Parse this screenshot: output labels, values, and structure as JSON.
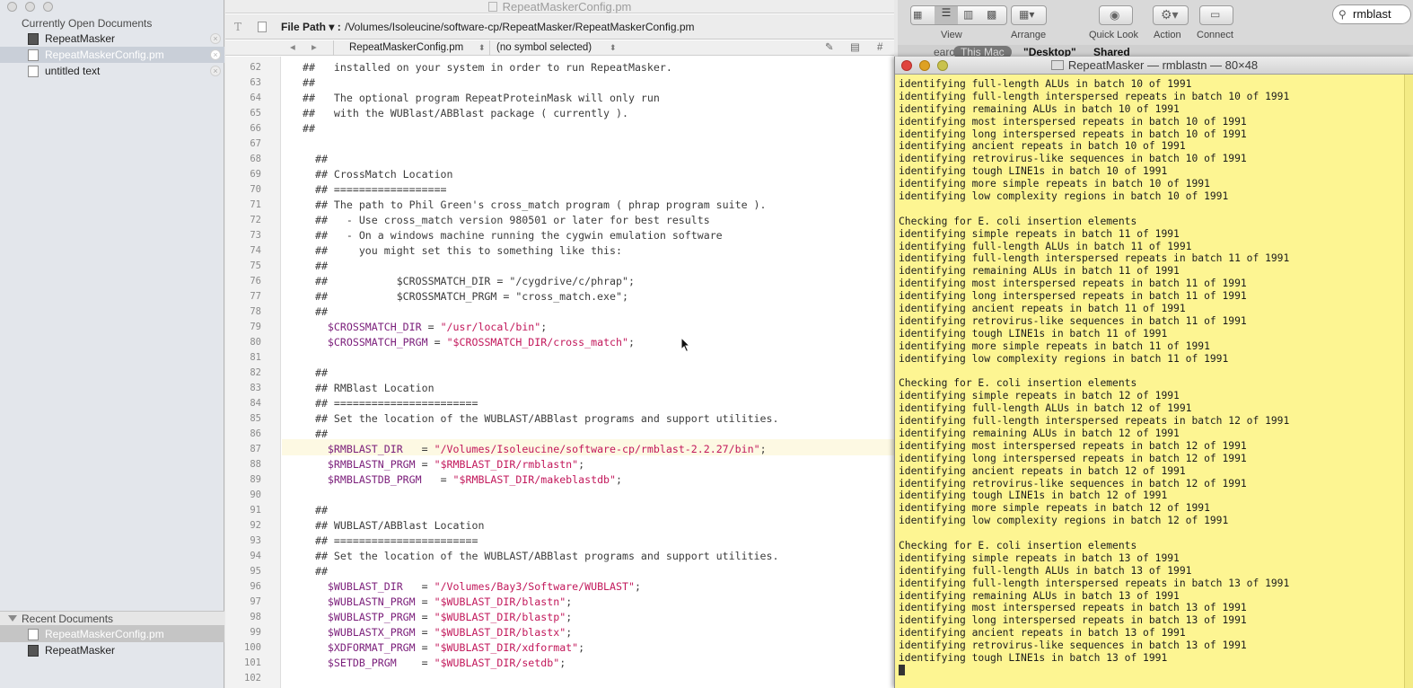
{
  "sidebar": {
    "open_header": "Currently Open Documents",
    "open_docs": [
      {
        "label": "RepeatMasker"
      },
      {
        "label": "RepeatMaskerConfig.pm"
      },
      {
        "label": "untitled text"
      }
    ],
    "recent_header": "Recent Documents",
    "recent_docs": [
      {
        "label": "RepeatMaskerConfig.pm"
      },
      {
        "label": "RepeatMasker"
      }
    ]
  },
  "editor": {
    "window_title": "RepeatMaskerConfig.pm",
    "path_label": "File Path ▾ :",
    "path_value": "/Volumes/Isoleucine/software-cp/RepeatMasker/RepeatMaskerConfig.pm",
    "nav_file": "RepeatMaskerConfig.pm",
    "nav_symbol": "(no symbol selected)",
    "lines": [
      {
        "n": "62",
        "parts": [
          {
            "t": "##   installed on your system in order to run RepeatMasker.",
            "c": ""
          }
        ]
      },
      {
        "n": "63",
        "parts": [
          {
            "t": "##",
            "c": ""
          }
        ]
      },
      {
        "n": "64",
        "parts": [
          {
            "t": "##   The optional program RepeatProteinMask will only run",
            "c": ""
          }
        ]
      },
      {
        "n": "65",
        "parts": [
          {
            "t": "##   with the WUBlast/ABBlast package ( currently ).",
            "c": ""
          }
        ]
      },
      {
        "n": "66",
        "parts": [
          {
            "t": "##",
            "c": ""
          }
        ]
      },
      {
        "n": "67",
        "parts": [
          {
            "t": "",
            "c": ""
          }
        ]
      },
      {
        "n": "68",
        "parts": [
          {
            "t": "  ##",
            "c": ""
          }
        ]
      },
      {
        "n": "69",
        "parts": [
          {
            "t": "  ## CrossMatch Location",
            "c": ""
          }
        ]
      },
      {
        "n": "70",
        "parts": [
          {
            "t": "  ## ==================",
            "c": ""
          }
        ]
      },
      {
        "n": "71",
        "parts": [
          {
            "t": "  ## The path to Phil Green's cross_match program ( phrap program suite ).",
            "c": ""
          }
        ]
      },
      {
        "n": "72",
        "parts": [
          {
            "t": "  ##   - Use cross_match version 980501 or later for best results",
            "c": ""
          }
        ]
      },
      {
        "n": "73",
        "parts": [
          {
            "t": "  ##   - On a windows machine running the cygwin emulation software",
            "c": ""
          }
        ]
      },
      {
        "n": "74",
        "parts": [
          {
            "t": "  ##     you might set this to something like this:",
            "c": ""
          }
        ]
      },
      {
        "n": "75",
        "parts": [
          {
            "t": "  ##",
            "c": ""
          }
        ]
      },
      {
        "n": "76",
        "parts": [
          {
            "t": "  ##           $CROSSMATCH_DIR = \"/cygdrive/c/phrap\";",
            "c": ""
          }
        ]
      },
      {
        "n": "77",
        "parts": [
          {
            "t": "  ##           $CROSSMATCH_PRGM = \"cross_match.exe\";",
            "c": ""
          }
        ]
      },
      {
        "n": "78",
        "parts": [
          {
            "t": "  ##",
            "c": ""
          }
        ]
      },
      {
        "n": "79",
        "parts": [
          {
            "t": "    $CROSSMATCH_DIR",
            "c": "var"
          },
          {
            "t": " = ",
            "c": ""
          },
          {
            "t": "\"/usr/local/bin\"",
            "c": "str"
          },
          {
            "t": ";",
            "c": ""
          }
        ]
      },
      {
        "n": "80",
        "parts": [
          {
            "t": "    $CROSSMATCH_PRGM",
            "c": "var"
          },
          {
            "t": " = ",
            "c": ""
          },
          {
            "t": "\"$CROSSMATCH_DIR/cross_match\"",
            "c": "str"
          },
          {
            "t": ";",
            "c": ""
          }
        ]
      },
      {
        "n": "81",
        "parts": [
          {
            "t": "",
            "c": ""
          }
        ]
      },
      {
        "n": "82",
        "parts": [
          {
            "t": "  ##",
            "c": ""
          }
        ]
      },
      {
        "n": "83",
        "parts": [
          {
            "t": "  ## RMBlast Location",
            "c": ""
          }
        ]
      },
      {
        "n": "84",
        "parts": [
          {
            "t": "  ## =======================",
            "c": ""
          }
        ]
      },
      {
        "n": "85",
        "parts": [
          {
            "t": "  ## Set the location of the WUBLAST/ABBlast programs and support utilities.",
            "c": ""
          }
        ]
      },
      {
        "n": "86",
        "parts": [
          {
            "t": "  ##",
            "c": ""
          }
        ]
      },
      {
        "n": "87",
        "parts": [
          {
            "t": "    $RMBLAST_DIR",
            "c": "var"
          },
          {
            "t": "   = ",
            "c": ""
          },
          {
            "t": "\"/Volumes/Isoleucine/software-cp/rmblast-2.2.27/bin\"",
            "c": "str"
          },
          {
            "t": ";",
            "c": ""
          }
        ]
      },
      {
        "n": "88",
        "parts": [
          {
            "t": "    $RMBLASTN_PRGM",
            "c": "var"
          },
          {
            "t": " = ",
            "c": ""
          },
          {
            "t": "\"$RMBLAST_DIR/rmblastn\"",
            "c": "str"
          },
          {
            "t": ";",
            "c": ""
          }
        ]
      },
      {
        "n": "89",
        "parts": [
          {
            "t": "    $RMBLASTDB_PRGM",
            "c": "var"
          },
          {
            "t": "   = ",
            "c": ""
          },
          {
            "t": "\"$RMBLAST_DIR/makeblastdb\"",
            "c": "str"
          },
          {
            "t": ";",
            "c": ""
          }
        ]
      },
      {
        "n": "90",
        "parts": [
          {
            "t": "",
            "c": ""
          }
        ]
      },
      {
        "n": "91",
        "parts": [
          {
            "t": "  ##",
            "c": ""
          }
        ]
      },
      {
        "n": "92",
        "parts": [
          {
            "t": "  ## WUBLAST/ABBlast Location",
            "c": ""
          }
        ]
      },
      {
        "n": "93",
        "parts": [
          {
            "t": "  ## =======================",
            "c": ""
          }
        ]
      },
      {
        "n": "94",
        "parts": [
          {
            "t": "  ## Set the location of the WUBLAST/ABBlast programs and support utilities.",
            "c": ""
          }
        ]
      },
      {
        "n": "95",
        "parts": [
          {
            "t": "  ##",
            "c": ""
          }
        ]
      },
      {
        "n": "96",
        "parts": [
          {
            "t": "    $WUBLAST_DIR",
            "c": "var"
          },
          {
            "t": "   = ",
            "c": ""
          },
          {
            "t": "\"/Volumes/Bay3/Software/WUBLAST\"",
            "c": "str"
          },
          {
            "t": ";",
            "c": ""
          }
        ]
      },
      {
        "n": "97",
        "parts": [
          {
            "t": "    $WUBLASTN_PRGM",
            "c": "var"
          },
          {
            "t": " = ",
            "c": ""
          },
          {
            "t": "\"$WUBLAST_DIR/blastn\"",
            "c": "str"
          },
          {
            "t": ";",
            "c": ""
          }
        ]
      },
      {
        "n": "98",
        "parts": [
          {
            "t": "    $WUBLASTP_PRGM",
            "c": "var"
          },
          {
            "t": " = ",
            "c": ""
          },
          {
            "t": "\"$WUBLAST_DIR/blastp\"",
            "c": "str"
          },
          {
            "t": ";",
            "c": ""
          }
        ]
      },
      {
        "n": "99",
        "parts": [
          {
            "t": "    $WUBLASTX_PRGM",
            "c": "var"
          },
          {
            "t": " = ",
            "c": ""
          },
          {
            "t": "\"$WUBLAST_DIR/blastx\"",
            "c": "str"
          },
          {
            "t": ";",
            "c": ""
          }
        ]
      },
      {
        "n": "100",
        "parts": [
          {
            "t": "    $XDFORMAT_PRGM",
            "c": "var"
          },
          {
            "t": " = ",
            "c": ""
          },
          {
            "t": "\"$WUBLAST_DIR/xdformat\"",
            "c": "str"
          },
          {
            "t": ";",
            "c": ""
          }
        ]
      },
      {
        "n": "101",
        "parts": [
          {
            "t": "    $SETDB_PRGM",
            "c": "var"
          },
          {
            "t": "    = ",
            "c": ""
          },
          {
            "t": "\"$WUBLAST_DIR/setdb\"",
            "c": "str"
          },
          {
            "t": ";",
            "c": ""
          }
        ]
      },
      {
        "n": "102",
        "parts": [
          {
            "t": "",
            "c": ""
          }
        ]
      }
    ]
  },
  "finder": {
    "view_label": "View",
    "arrange_label": "Arrange",
    "quicklook_label": "Quick Look",
    "action_label": "Action",
    "connect_label": "Connect",
    "search_value": "rmblast",
    "scope_search": "earch:",
    "scope_this_mac": "This Mac",
    "scope_desktop": "\"Desktop\"",
    "scope_shared": "Shared"
  },
  "terminal": {
    "title": "RepeatMasker — rmblastn — 80×48",
    "lines": [
      "identifying full-length ALUs in batch 10 of 1991",
      "identifying full-length interspersed repeats in batch 10 of 1991",
      "identifying remaining ALUs in batch 10 of 1991",
      "identifying most interspersed repeats in batch 10 of 1991",
      "identifying long interspersed repeats in batch 10 of 1991",
      "identifying ancient repeats in batch 10 of 1991",
      "identifying retrovirus-like sequences in batch 10 of 1991",
      "identifying tough LINE1s in batch 10 of 1991",
      "identifying more simple repeats in batch 10 of 1991",
      "identifying low complexity regions in batch 10 of 1991",
      "",
      "Checking for E. coli insertion elements",
      "identifying simple repeats in batch 11 of 1991",
      "identifying full-length ALUs in batch 11 of 1991",
      "identifying full-length interspersed repeats in batch 11 of 1991",
      "identifying remaining ALUs in batch 11 of 1991",
      "identifying most interspersed repeats in batch 11 of 1991",
      "identifying long interspersed repeats in batch 11 of 1991",
      "identifying ancient repeats in batch 11 of 1991",
      "identifying retrovirus-like sequences in batch 11 of 1991",
      "identifying tough LINE1s in batch 11 of 1991",
      "identifying more simple repeats in batch 11 of 1991",
      "identifying low complexity regions in batch 11 of 1991",
      "",
      "Checking for E. coli insertion elements",
      "identifying simple repeats in batch 12 of 1991",
      "identifying full-length ALUs in batch 12 of 1991",
      "identifying full-length interspersed repeats in batch 12 of 1991",
      "identifying remaining ALUs in batch 12 of 1991",
      "identifying most interspersed repeats in batch 12 of 1991",
      "identifying long interspersed repeats in batch 12 of 1991",
      "identifying ancient repeats in batch 12 of 1991",
      "identifying retrovirus-like sequences in batch 12 of 1991",
      "identifying tough LINE1s in batch 12 of 1991",
      "identifying more simple repeats in batch 12 of 1991",
      "identifying low complexity regions in batch 12 of 1991",
      "",
      "Checking for E. coli insertion elements",
      "identifying simple repeats in batch 13 of 1991",
      "identifying full-length ALUs in batch 13 of 1991",
      "identifying full-length interspersed repeats in batch 13 of 1991",
      "identifying remaining ALUs in batch 13 of 1991",
      "identifying most interspersed repeats in batch 13 of 1991",
      "identifying long interspersed repeats in batch 13 of 1991",
      "identifying ancient repeats in batch 13 of 1991",
      "identifying retrovirus-like sequences in batch 13 of 1991",
      "identifying tough LINE1s in batch 13 of 1991"
    ]
  },
  "colors": {
    "terminal_bg": "#fdf592",
    "code_variable": "#7a1d7a",
    "code_string": "#c2185b",
    "selection": "#c9cfd8"
  }
}
